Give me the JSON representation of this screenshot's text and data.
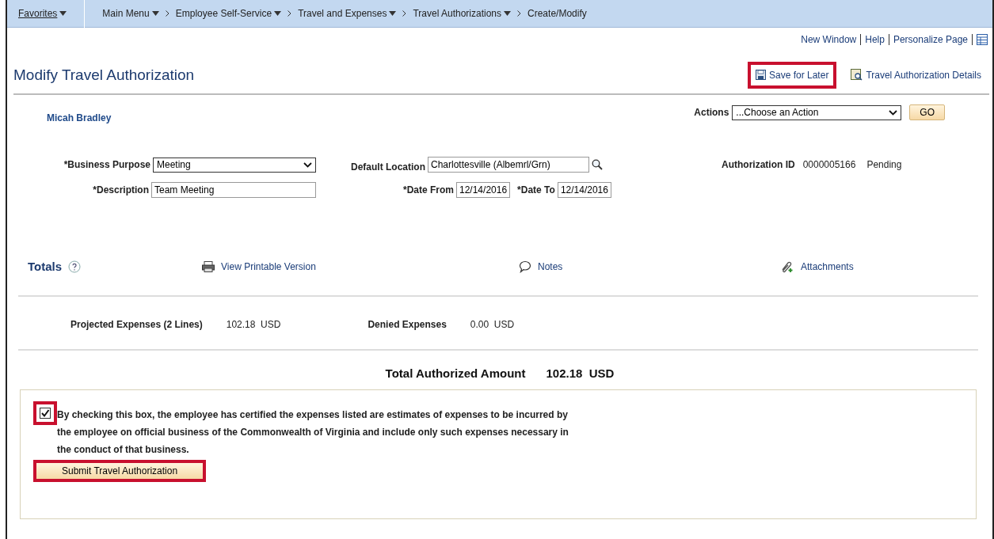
{
  "nav": {
    "items": [
      {
        "label": "Favorites",
        "kind": "menu"
      },
      {
        "label": "Main Menu",
        "kind": "menu"
      },
      {
        "label": "Employee Self-Service",
        "kind": "crumb-menu"
      },
      {
        "label": "Travel and Expenses",
        "kind": "crumb-menu"
      },
      {
        "label": "Travel Authorizations",
        "kind": "crumb-menu"
      },
      {
        "label": "Create/Modify",
        "kind": "crumb"
      }
    ]
  },
  "page_links": [
    "New Window",
    "Help",
    "Personalize Page"
  ],
  "title": "Modify Travel Authorization",
  "title_actions": [
    {
      "label": "Save for Later",
      "kind": "save",
      "highlighted": true
    },
    {
      "label": "Travel Authorization Details",
      "kind": "details",
      "highlighted": false
    }
  ],
  "employee": "Micah Bradley",
  "actions": {
    "label": "Actions",
    "value": "...Choose an Action",
    "button": "GO"
  },
  "fields": {
    "business_purpose": {
      "label": "*Business Purpose",
      "value": "Meeting"
    },
    "description": {
      "label": "*Description",
      "value": "Team Meeting"
    },
    "default_location": {
      "label": "Default Location",
      "value": "Charlottesville (Albemrl/Grn)"
    },
    "date_from": {
      "label": "*Date From",
      "value": "12/14/2016"
    },
    "date_to": {
      "label": "*Date To",
      "value": "12/14/2016"
    },
    "authorization_id": {
      "label": "Authorization ID",
      "value": "0000005166",
      "status": "Pending"
    }
  },
  "totals": {
    "label": "Totals",
    "links": [
      {
        "label": "View Printable Version",
        "kind": "print"
      },
      {
        "label": "Notes",
        "kind": "notes"
      },
      {
        "label": "Attachments",
        "kind": "attach"
      }
    ]
  },
  "expenses": [
    {
      "label": "Projected Expenses (2 Lines)",
      "amount": "102.18",
      "currency": "USD"
    },
    {
      "label": "Denied Expenses",
      "amount": "0.00",
      "currency": "USD"
    }
  ],
  "total_authorized": {
    "label": "Total Authorized Amount",
    "amount": "102.18",
    "currency": "USD"
  },
  "certification": {
    "checked": true,
    "highlighted": true,
    "text": "By checking this box, the employee has certified the expenses listed are estimates of expenses to be incurred by the employee on official business of the Commonwealth of Virginia and include only such expenses necessary in the conduct of that business."
  },
  "submit": {
    "label": "Submit Travel Authorization",
    "highlighted": true
  }
}
